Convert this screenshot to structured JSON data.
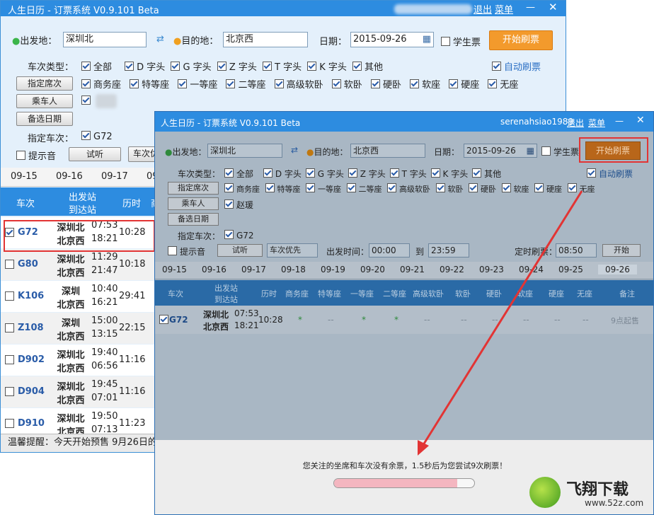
{
  "app": {
    "title": "人生日历 - 订票系统 V0.9.101 Beta"
  },
  "back": {
    "header_links": {
      "logout": "退出",
      "menu": "菜单",
      "minimize": "—",
      "close": "✕"
    },
    "from_label": "出发地：",
    "from_value": "深圳北",
    "to_label": "目的地：",
    "to_value": "北京西",
    "date_label": "日期：",
    "date_value": "2015-09-26",
    "student_label": "学生票",
    "start_button": "开始刷票",
    "train_type_label": "车次类型：",
    "train_types": [
      "全部",
      "D 字头",
      "G 字头",
      "Z 字头",
      "T 字头",
      "K 字头",
      "其他"
    ],
    "auto_refresh": "自动刷票",
    "seat_button": "指定席次",
    "seats": [
      "商务座",
      "特等座",
      "一等座",
      "二等座",
      "高级软卧",
      "软卧",
      "硬卧",
      "软座",
      "硬座",
      "无座"
    ],
    "passenger_button": "乘车人",
    "alt_date_button": "备选日期",
    "specified_train_label": "指定车次：",
    "specified_train": "G72",
    "sound_label": "提示音",
    "listen_button": "试听",
    "priority_button": "车次优",
    "dates": [
      "09-15",
      "09-16",
      "09-17",
      "09"
    ],
    "headers": {
      "train": "车次",
      "stations_top": "出发站",
      "stations_bottom": "到达站",
      "duration": "历时",
      "cut": "商"
    },
    "rows": [
      {
        "code": "G72",
        "from": "深圳北",
        "to": "北京西",
        "dep": "07:53",
        "arr": "18:21",
        "dur": "10:28",
        "checked": true
      },
      {
        "code": "G80",
        "from": "深圳北",
        "to": "北京西",
        "dep": "11:29",
        "arr": "21:47",
        "dur": "10:18",
        "checked": false
      },
      {
        "code": "K106",
        "from": "深圳",
        "to": "北京西",
        "dep": "10:40",
        "arr": "16:21",
        "dur": "29:41",
        "checked": false
      },
      {
        "code": "Z108",
        "from": "深圳",
        "to": "北京西",
        "dep": "15:00",
        "arr": "13:15",
        "dur": "22:15",
        "checked": false
      },
      {
        "code": "D902",
        "from": "深圳北",
        "to": "北京西",
        "dep": "19:40",
        "arr": "06:56",
        "dur": "11:16",
        "checked": false
      },
      {
        "code": "D904",
        "from": "深圳北",
        "to": "北京西",
        "dep": "19:45",
        "arr": "07:01",
        "dur": "11:16",
        "checked": false
      },
      {
        "code": "D910",
        "from": "深圳北",
        "to": "北京西",
        "dep": "19:50",
        "arr": "07:13",
        "dur": "11:23",
        "checked": false
      }
    ],
    "tip": "温馨提醒：今天开始预售 9月26日的"
  },
  "front": {
    "user": "serenahsiao1989",
    "logout": "退出",
    "menu": "菜单",
    "minimize": "—",
    "close": "✕",
    "from_label": "出发地：",
    "from_value": "深圳北",
    "to_label": "目的地：",
    "to_value": "北京西",
    "date_label": "日期：",
    "date_value": "2015-09-26",
    "student_label": "学生票",
    "start_button": "开始刷票",
    "train_type_label": "车次类型：",
    "train_types": [
      "全部",
      "D 字头",
      "G 字头",
      "Z 字头",
      "T 字头",
      "K 字头",
      "其他"
    ],
    "auto_refresh": "自动刷票",
    "seat_button": "指定席次",
    "seats": [
      "商务座",
      "特等座",
      "一等座",
      "二等座",
      "高级软卧",
      "软卧",
      "硬卧",
      "软座",
      "硬座",
      "无座"
    ],
    "passenger_button": "乘车人",
    "passenger_name": "赵瑗",
    "alt_date_button": "备选日期",
    "specified_train_label": "指定车次：",
    "specified_train": "G72",
    "sound_label": "提示音",
    "listen_button": "试听",
    "priority_select": "车次优先",
    "depart_time_label": "出发时间：",
    "depart_from": "00:00",
    "to_word": "到",
    "depart_to": "23:59",
    "timed_label": "定时刷票：",
    "timed_value": "08:50",
    "go_button": "开始",
    "dates": [
      "09-15",
      "09-16",
      "09-17",
      "09-18",
      "09-19",
      "09-20",
      "09-21",
      "09-22",
      "09-23",
      "09-24",
      "09-25",
      "09-26"
    ],
    "headers": [
      "车次",
      "出发站",
      "到达站",
      "历时",
      "商务座",
      "特等座",
      "一等座",
      "二等座",
      "高级软卧",
      "软卧",
      "硬卧",
      "软座",
      "硬座",
      "无座",
      "备注"
    ],
    "row": {
      "code": "G72",
      "from": "深圳北",
      "to": "北京西",
      "dep": "07:53",
      "arr": "18:21",
      "dur": "10:28",
      "cells": [
        "*",
        "--",
        "*",
        "*",
        "--",
        "--",
        "--",
        "--",
        "--",
        "--"
      ],
      "note": "9点起售"
    },
    "message": "您关注的坐席和车次没有余票，1.5秒后为您尝试9次刷票！",
    "progress": 0.88
  },
  "watermark": {
    "text": "飞翔下载",
    "url": "www.52z.com"
  },
  "colors": {
    "accent": "#2d8ce0",
    "start_button": "#f39a2c",
    "highlight": "#e23434",
    "train_code": "#2a5ca8"
  }
}
